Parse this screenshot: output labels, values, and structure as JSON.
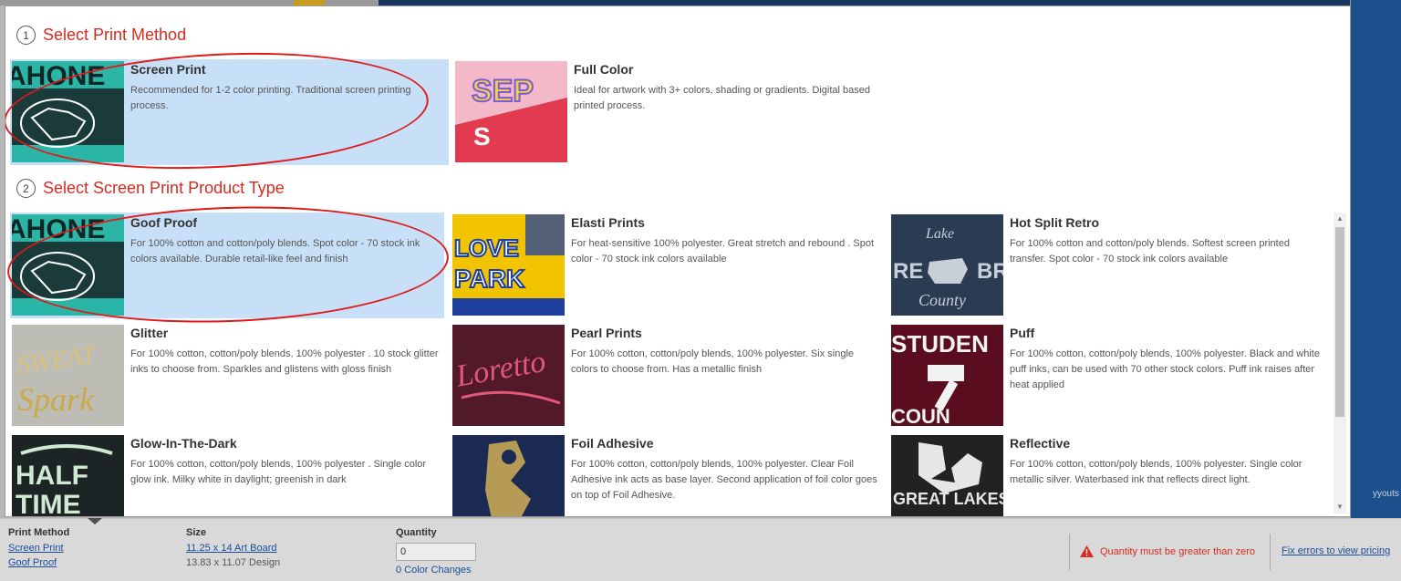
{
  "step1": {
    "number": "1",
    "title": "Select Print Method"
  },
  "step2": {
    "number": "2",
    "title": "Select Screen Print Product Type"
  },
  "print_methods": [
    {
      "title": "Screen Print",
      "description": "Recommended for 1-2 color printing. Traditional screen printing process.",
      "selected": true
    },
    {
      "title": "Full Color",
      "description": "Ideal for artwork with 3+ colors, shading or gradients. Digital based printed process.",
      "selected": false
    }
  ],
  "product_types": [
    {
      "title": "Goof Proof",
      "description": "For 100% cotton and cotton/poly blends. Spot color - 70 stock ink colors available. Durable retail-like feel and finish",
      "selected": true
    },
    {
      "title": "Elasti Prints",
      "description": "For heat-sensitive 100% polyester. Great stretch and rebound . Spot color - 70 stock ink colors available",
      "selected": false
    },
    {
      "title": "Hot Split Retro",
      "description": "For 100% cotton and cotton/poly blends. Softest screen printed transfer. Spot color - 70 stock ink colors available",
      "selected": false
    },
    {
      "title": "Glitter",
      "description": "For 100% cotton, cotton/poly blends, 100% polyester . 10 stock glitter inks to choose from. Sparkles and glistens with gloss finish",
      "selected": false
    },
    {
      "title": "Pearl Prints",
      "description": "For 100% cotton, cotton/poly blends, 100% polyester. Six single colors to choose from. Has a metallic finish",
      "selected": false
    },
    {
      "title": "Puff",
      "description": "For 100% cotton, cotton/poly blends, 100% polyester. Black and white puff inks, can be used with 70 other stock colors. Puff ink raises after heat applied",
      "selected": false
    },
    {
      "title": "Glow-In-The-Dark",
      "description": "For 100% cotton, cotton/poly blends, 100% polyester . Single color glow ink. Milky white in daylight; greenish in dark",
      "selected": false
    },
    {
      "title": "Foil Adhesive",
      "description": "For 100% cotton, cotton/poly blends, 100% polyester. Clear Foil Adhesive ink acts as base layer. Second application of foil color goes on top of Foil Adhesive.",
      "selected": false
    },
    {
      "title": "Reflective",
      "description": "For 100% cotton, cotton/poly blends, 100% polyester. Single color metallic silver. Waterbased ink that reflects direct light.",
      "selected": false
    }
  ],
  "footer": {
    "print_method_label": "Print Method",
    "print_method_value": "Screen Print",
    "product_type_value": "Goof Proof",
    "size_label": "Size",
    "size_value": "11.25 x 14 Art Board",
    "design_size": "13.83 x 11.07 Design",
    "quantity_label": "Quantity",
    "quantity_value": "0",
    "color_changes": "0 Color Changes",
    "error_message": "Quantity must be greater than zero",
    "fix_link": "Fix errors to view pricing"
  },
  "background_peek_text": "yyouts Use",
  "colors": {
    "accent_red": "#d62c20",
    "selected_bg": "#c7e0f7",
    "link_blue": "#1a4d9c",
    "side_blue": "#1d4f8c"
  }
}
